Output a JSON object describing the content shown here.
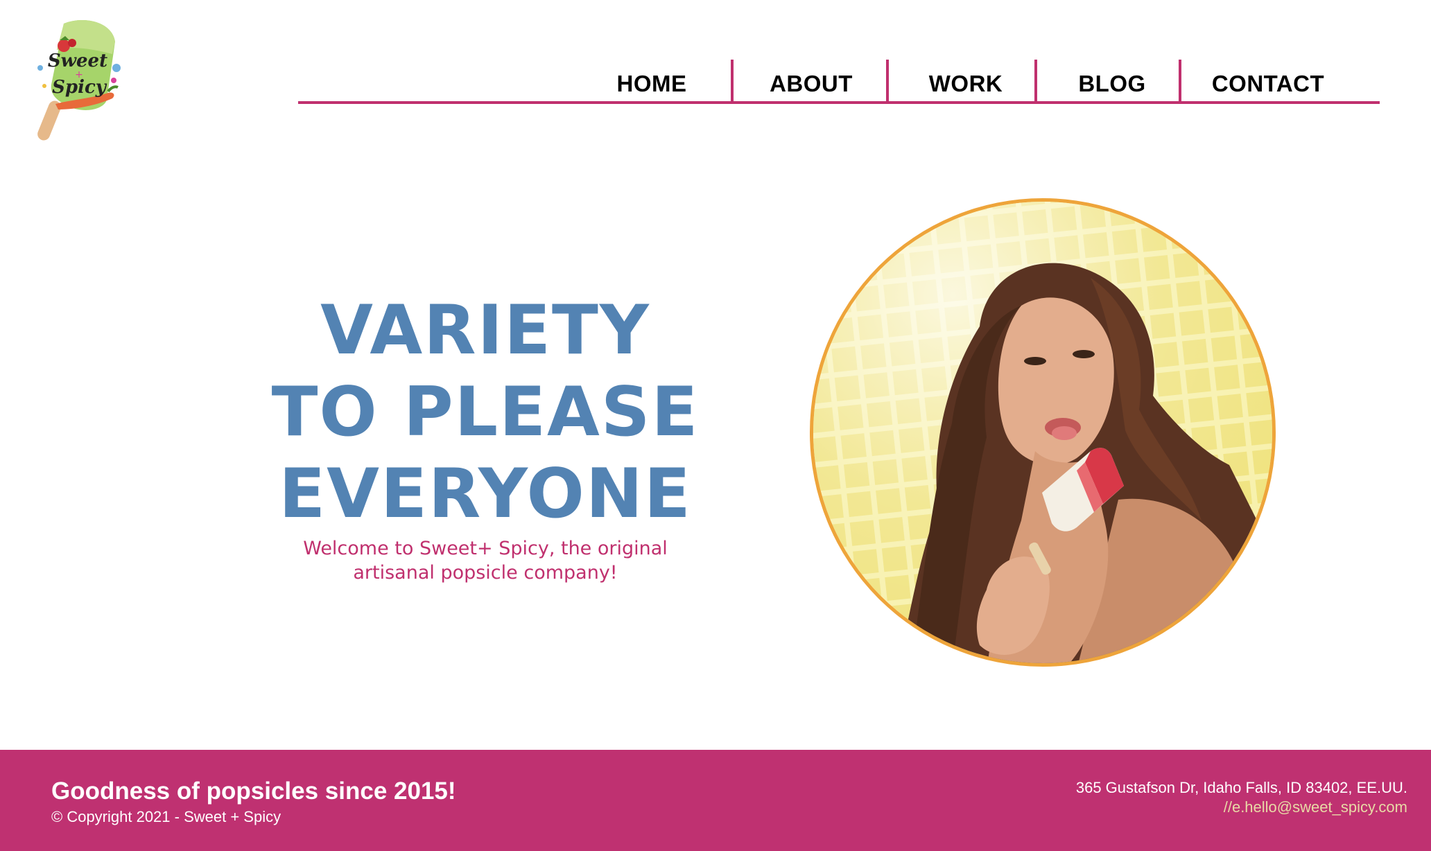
{
  "brand": {
    "logo_icon": "popsicle-logo",
    "logo_text_line1": "Sweet",
    "logo_text_plus": "+",
    "logo_text_line2": "Spicy"
  },
  "nav": {
    "items": [
      {
        "label": "HOME"
      },
      {
        "label": "ABOUT"
      },
      {
        "label": "WORK"
      },
      {
        "label": "BLOG"
      },
      {
        "label": "CONTACT"
      }
    ]
  },
  "hero": {
    "headline_line1": "VARIETY",
    "headline_line2": "TO PLEASE",
    "headline_line3": "EVERYONE",
    "subtitle_line1": "Welcome to Sweet+ Spicy, the original",
    "subtitle_line2": "artisanal popsicle company!",
    "image_icon": "woman-eating-popsicle-photo"
  },
  "footer": {
    "tagline": "Goodness of popsicles since 2015!",
    "copyright": "© Copyright 2021 - Sweet + Spicy",
    "address": "365 Gustafson Dr, Idaho Falls, ID 83402, EE.UU.",
    "email": "//e.hello@sweet_spicy.com"
  },
  "colors": {
    "accent_pink": "#c0306e",
    "headline_blue": "#5383b3",
    "photo_ring_orange": "#eea43a",
    "footer_bg": "#bf3171",
    "email_color": "#e8d9a6"
  }
}
